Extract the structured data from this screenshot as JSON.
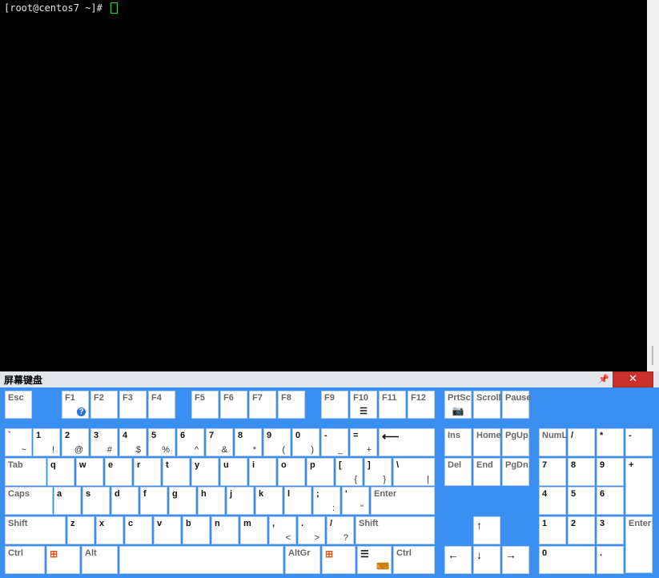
{
  "terminal": {
    "prompt": "[root@centos7 ~]# "
  },
  "osk": {
    "title": "屏幕键盘",
    "pin_icon": "pin-icon",
    "close_icon": "close-icon",
    "keys": {
      "esc": "Esc",
      "f1": "F1",
      "f2": "F2",
      "f3": "F3",
      "f4": "F4",
      "f5": "F5",
      "f6": "F6",
      "f7": "F7",
      "f8": "F8",
      "f9": "F9",
      "f10": "F10",
      "f11": "F11",
      "f12": "F12",
      "prtsc": "PrtSc",
      "scroll": "Scroll",
      "pause": "Pause",
      "grave": "`",
      "grave2": "~",
      "k1": "1",
      "k1s": "!",
      "k2": "2",
      "k2s": "@",
      "k3": "3",
      "k3s": "#",
      "k4": "4",
      "k4s": "$",
      "k5": "5",
      "k5s": "%",
      "k6": "6",
      "k6s": "^",
      "k7": "7",
      "k7s": "&",
      "k8": "8",
      "k8s": "*",
      "k9": "9",
      "k9s": "(",
      "k0": "0",
      "k0s": ")",
      "minus": "-",
      "minus2": "_",
      "equal": "=",
      "equal2": "+",
      "backspace": "⟵",
      "ins": "Ins",
      "home": "Home",
      "pgup": "PgUp",
      "numlock": "NumL",
      "npdiv": "/",
      "npmul": "*",
      "npsub": "-",
      "tab": "Tab",
      "q": "q",
      "w": "w",
      "e": "e",
      "r": "r",
      "t": "t",
      "y": "y",
      "u": "u",
      "i": "i",
      "o": "o",
      "p": "p",
      "lbr": "[",
      "lbr2": "{",
      "rbr": "]",
      "rbr2": "}",
      "bslash": "\\",
      "bslash2": "|",
      "del": "Del",
      "end": "End",
      "pgdn": "PgDn",
      "np7": "7",
      "np8": "8",
      "np9": "9",
      "npadd": "+",
      "caps": "Caps",
      "a": "a",
      "s": "s",
      "d": "d",
      "f": "f",
      "g": "g",
      "h": "h",
      "j": "j",
      "k": "k",
      "l": "l",
      "semi": ";",
      "semi2": ":",
      "quote": "'",
      "quote2": "\"",
      "enter": "Enter",
      "np4": "4",
      "np5": "5",
      "np6": "6",
      "shift": "Shift",
      "z": "z",
      "x": "x",
      "c": "c",
      "v": "v",
      "b": "b",
      "n": "n",
      "m": "m",
      "comma": ",",
      "comma2": "<",
      "period": ".",
      "period2": ">",
      "slash": "/",
      "slash2": "?",
      "rshift": "Shift",
      "up": "↑",
      "np1": "1",
      "np2": "2",
      "np3": "3",
      "npenter": "Enter",
      "ctrl": "Ctrl",
      "alt": "Alt",
      "altgr": "AltGr",
      "rctrl": "Ctrl",
      "left": "←",
      "down": "↓",
      "right": "→",
      "np0": "0",
      "npdot": "."
    }
  }
}
